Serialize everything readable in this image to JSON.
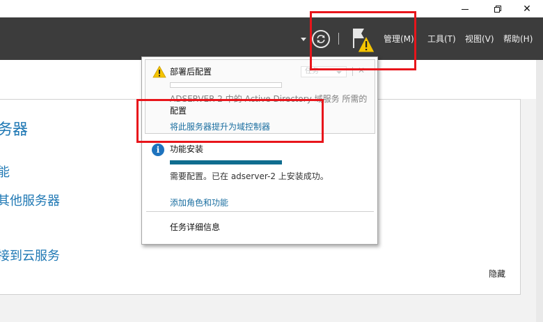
{
  "window": {
    "minimize_icon": "minimize-icon",
    "restore_icon": "restore-icon",
    "close_glyph": "✕"
  },
  "toolbar": {
    "menus": [
      "管理(M)",
      "工具(T)",
      "视图(V)",
      "帮助(H)"
    ],
    "refresh_icon": "refresh-icon",
    "flag_icon": "notification-flag-warning-icon"
  },
  "background": {
    "servers_title": "务器",
    "item_func": "能",
    "item_other_servers": "其他服务器",
    "item_cloud": "接到云服务",
    "hide_link": "隐藏"
  },
  "notifications": {
    "post_deploy": {
      "title": "部署后配置",
      "combo_value": "任务",
      "close_glyph": "✕",
      "desc_line1": "ADSERVER-2 中的 Active Directory 域服务 所需的",
      "desc_line2": "配置",
      "link": "将此服务器提升为域控制器",
      "progress": 0
    },
    "feature_install": {
      "title": "功能安装",
      "progress": 100,
      "status": "需要配置。已在 adserver-2 上安装成功。",
      "link": "添加角色和功能"
    },
    "task_details": "任务详细信息"
  },
  "colors": {
    "toolbar_bg": "#3c3c3c",
    "link": "#1a6ea0",
    "progress_fill": "#0f6d8f",
    "info_icon": "#1e73be",
    "warning": "#f5c400",
    "annotation_red": "#e8151b"
  }
}
